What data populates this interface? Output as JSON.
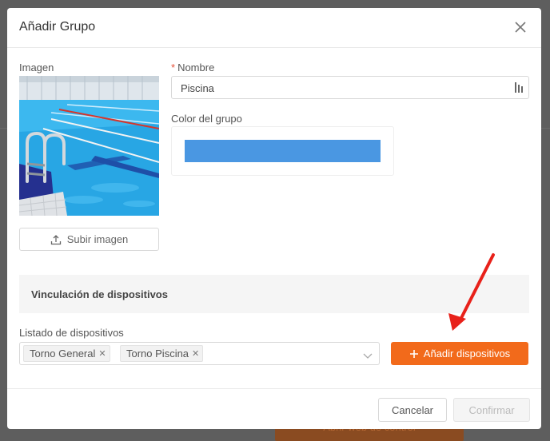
{
  "modal": {
    "title": "Añadir Grupo"
  },
  "image_section": {
    "label": "Imagen",
    "upload_label": "Subir imagen"
  },
  "name_field": {
    "required_mark": "*",
    "label": "Nombre",
    "value": "Piscina"
  },
  "group_color": {
    "label": "Color del grupo",
    "color": "#4a97e2"
  },
  "devices_section": {
    "title": "Vinculación de dispositivos",
    "list_label": "Listado de dispositivos",
    "selected": [
      "Torno General",
      "Torno Piscina"
    ],
    "add_button_label": "Añadir dispositivos"
  },
  "footer": {
    "cancel_label": "Cancelar",
    "confirm_label": "Confirmar"
  },
  "background": {
    "button_text": "Abrir web de control"
  },
  "colors": {
    "accent": "#f26a1b",
    "annotation_arrow": "#e8211a"
  }
}
